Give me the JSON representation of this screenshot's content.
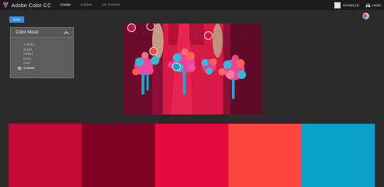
{
  "header": {
    "app_title": "Adobe Color CC",
    "nav": [
      {
        "label": "Create",
        "active": true
      },
      {
        "label": "Explore",
        "active": false
      },
      {
        "label": "My Themes",
        "active": false
      }
    ],
    "user_name": "DANIELLE",
    "adobe_label": "Adobe"
  },
  "toolbar": {
    "save_label": "Save"
  },
  "mood": {
    "title": "Color Mood",
    "items": [
      "Colorful",
      "Bright",
      "Muted",
      "Deep",
      "Dark",
      "Custom"
    ],
    "selected": "Custom"
  },
  "palette": {
    "colors": [
      "#c40838",
      "#7c0123",
      "#e40a3d",
      "#ff4540",
      "#0a9fc9"
    ]
  },
  "icons": {
    "logo": "adobe-color-logo-icon",
    "chevron": "chevron-up-icon",
    "color_wheel": "color-wheel-icon",
    "adobe": "adobe-logo-icon"
  }
}
